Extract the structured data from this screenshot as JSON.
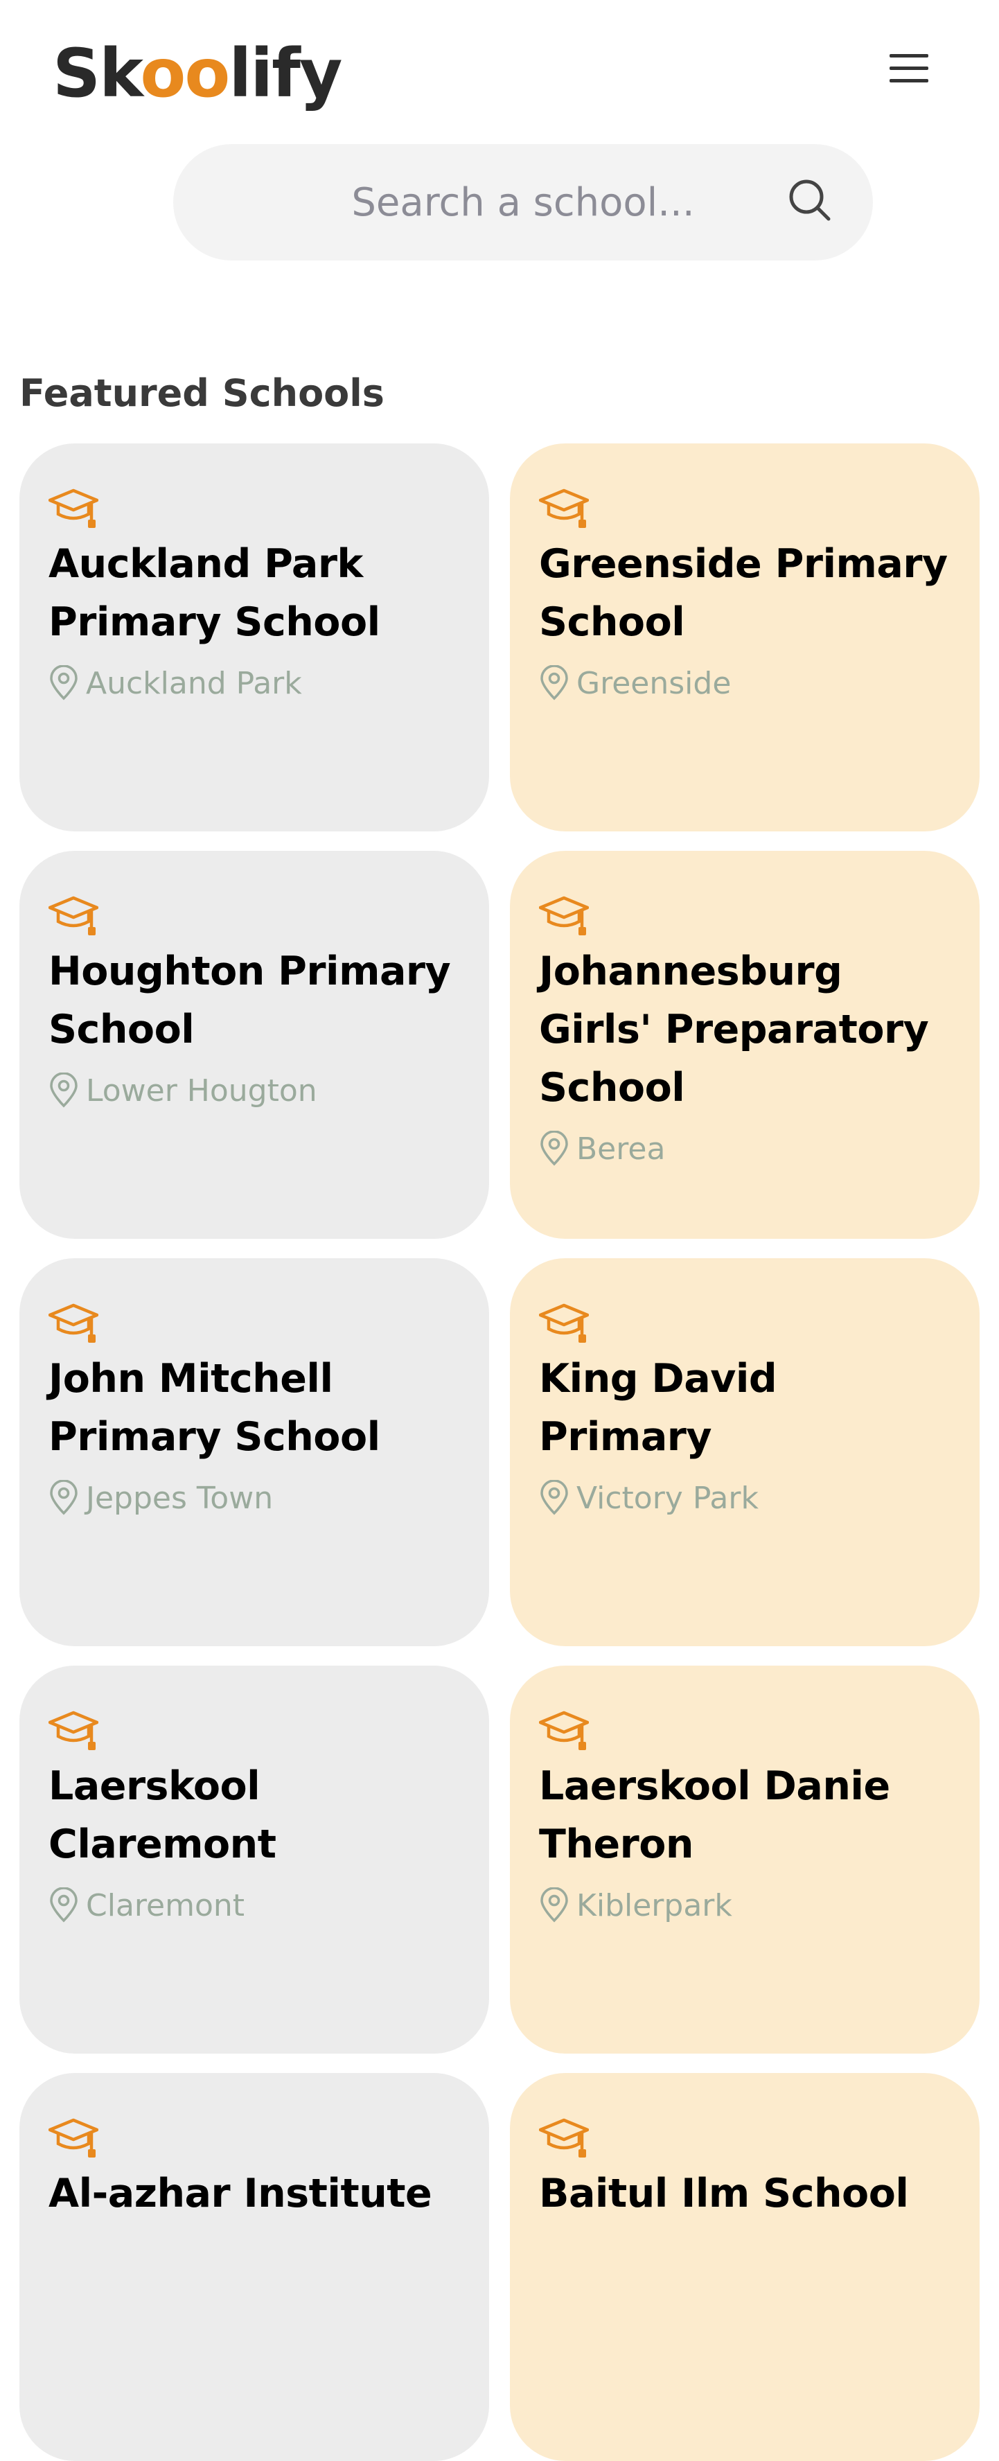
{
  "header": {
    "logo_parts": [
      "Sk",
      "oo",
      "lify"
    ],
    "menu_icon": "hamburger-menu-icon"
  },
  "search": {
    "placeholder": "Search a school...",
    "icon": "search-icon"
  },
  "featured": {
    "title": "Featured Schools",
    "schools": [
      {
        "name": "Auckland Park Primary School",
        "location": "Auckland Park"
      },
      {
        "name": "Greenside Primary School",
        "location": "Greenside"
      },
      {
        "name": "Houghton Primary School",
        "location": "Lower Hougton"
      },
      {
        "name": "Johannesburg Girls' Preparatory School",
        "location": "Berea"
      },
      {
        "name": "John Mitchell Primary School",
        "location": "Jeppes Town"
      },
      {
        "name": "King David Primary",
        "location": "Victory Park"
      },
      {
        "name": "Laerskool Claremont",
        "location": "Claremont"
      },
      {
        "name": "Laerskool Danie Theron",
        "location": "Kiblerpark"
      },
      {
        "name": "Al-azhar Institute",
        "location": ""
      },
      {
        "name": "Baitul Ilm School",
        "location": ""
      }
    ]
  },
  "colors": {
    "accent": "#e8891e",
    "card_grey": "#ececec",
    "card_cream": "#fcebcd",
    "location_text": "#9aaa9c"
  }
}
